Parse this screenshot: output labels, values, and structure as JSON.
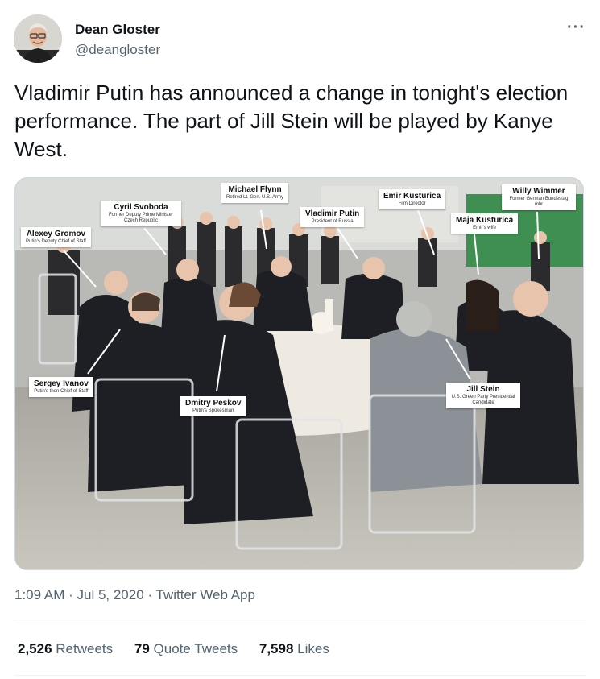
{
  "author": {
    "name": "Dean Gloster",
    "handle": "@deangloster",
    "avatar_icon": "avatar-photo"
  },
  "menu_icon": "more-dots-icon",
  "tweet": {
    "text": "Vladimir Putin has announced a change in tonight's election performance. The part of Jill Stein will be played by Kanye West."
  },
  "photo_labels": [
    {
      "name": "Michael Flynn",
      "sub": "Retired Lt. Gen. U.S. Army"
    },
    {
      "name": "Cyril Svoboda",
      "sub": "Former Deputy Prime Minister Czech Republic"
    },
    {
      "name": "Emir Kusturica",
      "sub": "Film Director"
    },
    {
      "name": "Willy Wimmer",
      "sub": "Former German Bundestag mbr"
    },
    {
      "name": "Vladimir Putin",
      "sub": "President of Russia"
    },
    {
      "name": "Maja Kusturica",
      "sub": "Emir's wife"
    },
    {
      "name": "Alexey Gromov",
      "sub": "Putin's Deputy Chief of Staff"
    },
    {
      "name": "Sergey Ivanov",
      "sub": "Putin's then Chief of Staff"
    },
    {
      "name": "Dmitry Peskov",
      "sub": "Putin's Spokesman"
    },
    {
      "name": "Jill Stein",
      "sub": "U.S. Green Party Presidential Candidate"
    }
  ],
  "meta": {
    "time": "1:09 AM",
    "sep1": " · ",
    "date": "Jul 5, 2020",
    "sep2": " · ",
    "source": "Twitter Web App"
  },
  "stats": {
    "retweets_count": "2,526",
    "retweets_label": "Retweets",
    "quotes_count": "79",
    "quotes_label": "Quote Tweets",
    "likes_count": "7,598",
    "likes_label": "Likes"
  }
}
